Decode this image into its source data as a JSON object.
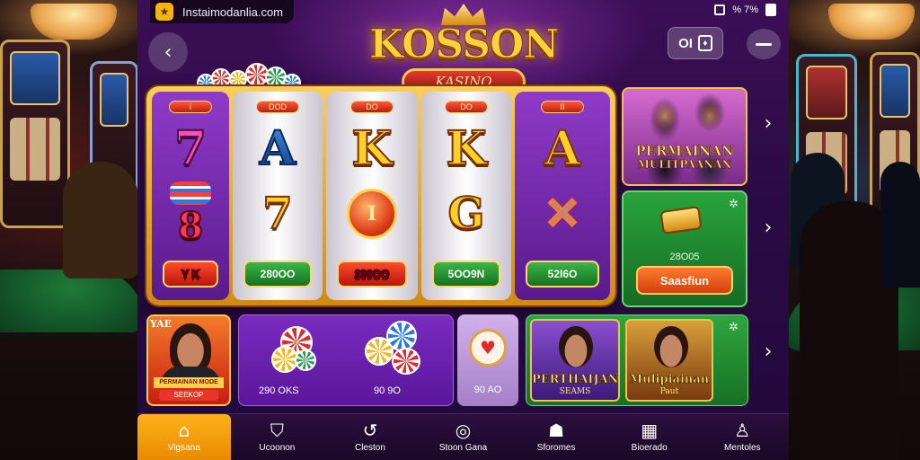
{
  "browser": {
    "url": "Instaimodanlia.com",
    "status_text": "% 7%"
  },
  "header": {
    "logo_title": "KOSSON",
    "logo_subtitle": "KASINO",
    "control_label": "OI"
  },
  "reels": [
    {
      "tag": "I",
      "top": "7",
      "bottom": "8",
      "bet": "Y K"
    },
    {
      "tag": "DOD",
      "top": "A",
      "bottom": "7",
      "bet": "280OO"
    },
    {
      "tag": "DO",
      "top": "K",
      "bottom": "I",
      "bet": "290OO"
    },
    {
      "tag": "DO",
      "top": "K",
      "bottom": "G",
      "bet": "5OO9N"
    },
    {
      "tag": "II",
      "top": "A",
      "bottom": "✕",
      "bet": "52I6O"
    }
  ],
  "promo": {
    "line1": "PERMAINAN",
    "line2": "MULITPAANAN"
  },
  "bonus": {
    "value": "28O05",
    "button": "Saasfiun"
  },
  "bottom_row": {
    "hero": {
      "tag": "YAE",
      "banner": "PERMAINAN MODE",
      "banner2": "SEEKOP"
    },
    "chips": {
      "left_label": "290 OKS",
      "right_label": "90 9O"
    },
    "small_card": {
      "label": "90 AO"
    },
    "game_a": {
      "title": "PERTHAIJANS",
      "sub": "SEAMS"
    },
    "game_b": {
      "title": "Mulipiainan",
      "sub": "Paut"
    }
  },
  "nav": [
    {
      "label": "Vigsana",
      "icon": "home-icon"
    },
    {
      "label": "Ucoonon",
      "icon": "shield-icon"
    },
    {
      "label": "Cleston",
      "icon": "cycle-icon"
    },
    {
      "label": "Stoon Gana",
      "icon": "ring-icon"
    },
    {
      "label": "Sforomes",
      "icon": "group-icon"
    },
    {
      "label": "Bioerado",
      "icon": "grid-icon"
    },
    {
      "label": "Mentoles",
      "icon": "user-icon"
    }
  ],
  "colors": {
    "panel_purple": "#2a0a44",
    "gold": "#ffcf2a",
    "nav_active": "#ffb21a",
    "bonus_green": "#29a33c"
  }
}
